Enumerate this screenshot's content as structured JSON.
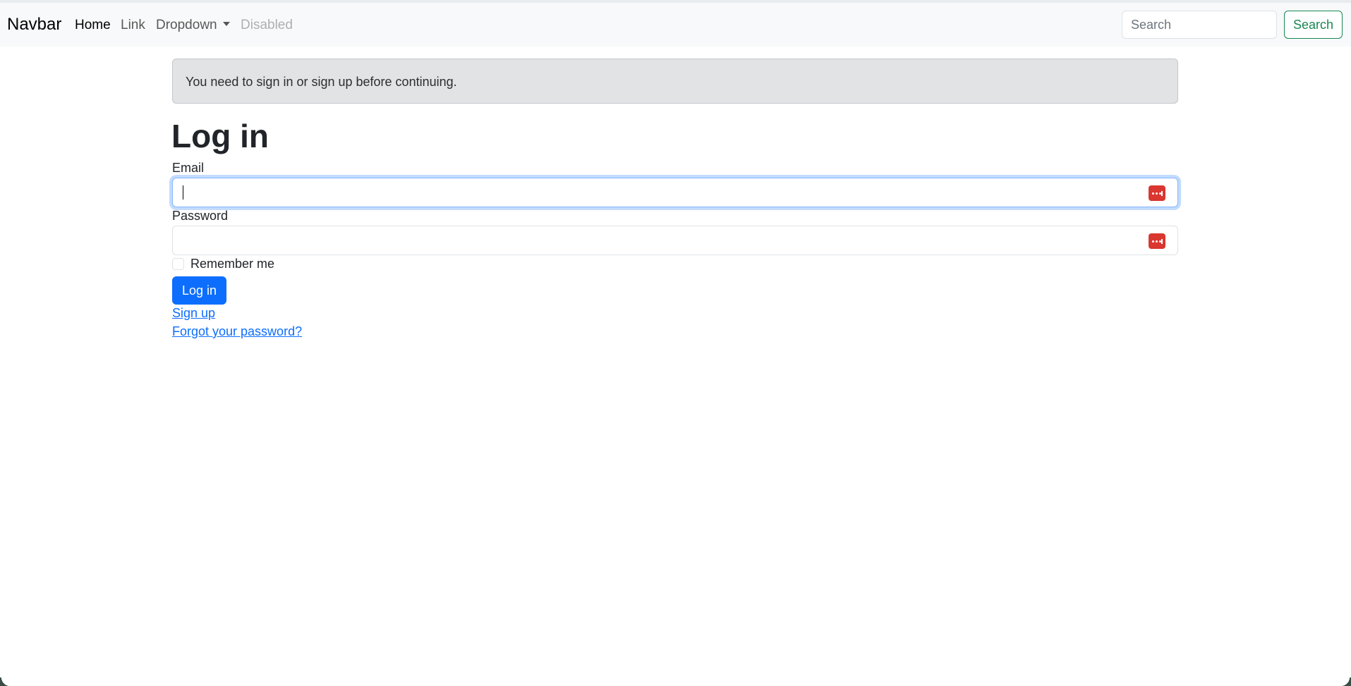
{
  "navbar": {
    "brand": "Navbar",
    "links": [
      {
        "label": "Home",
        "state": "active"
      },
      {
        "label": "Link",
        "state": "normal"
      },
      {
        "label": "Dropdown",
        "state": "normal"
      },
      {
        "label": "Disabled",
        "state": "disabled"
      }
    ],
    "search_placeholder": "Search",
    "search_button": "Search"
  },
  "alert": {
    "message": "You need to sign in or sign up before continuing."
  },
  "form": {
    "title": "Log in",
    "email_label": "Email",
    "email_value": "",
    "password_label": "Password",
    "password_value": "",
    "remember_label": "Remember me",
    "remember_checked": false,
    "submit_label": "Log in",
    "field_icon": "password-manager-icon"
  },
  "links": {
    "sign_up": "Sign up",
    "forgot_password": "Forgot your password?"
  },
  "colors": {
    "primary": "#0d6efd",
    "success": "#198754",
    "alert_bg": "#e2e3e5",
    "navbar_bg": "#f8f9fa",
    "password_manager_icon": "#d9372f"
  }
}
